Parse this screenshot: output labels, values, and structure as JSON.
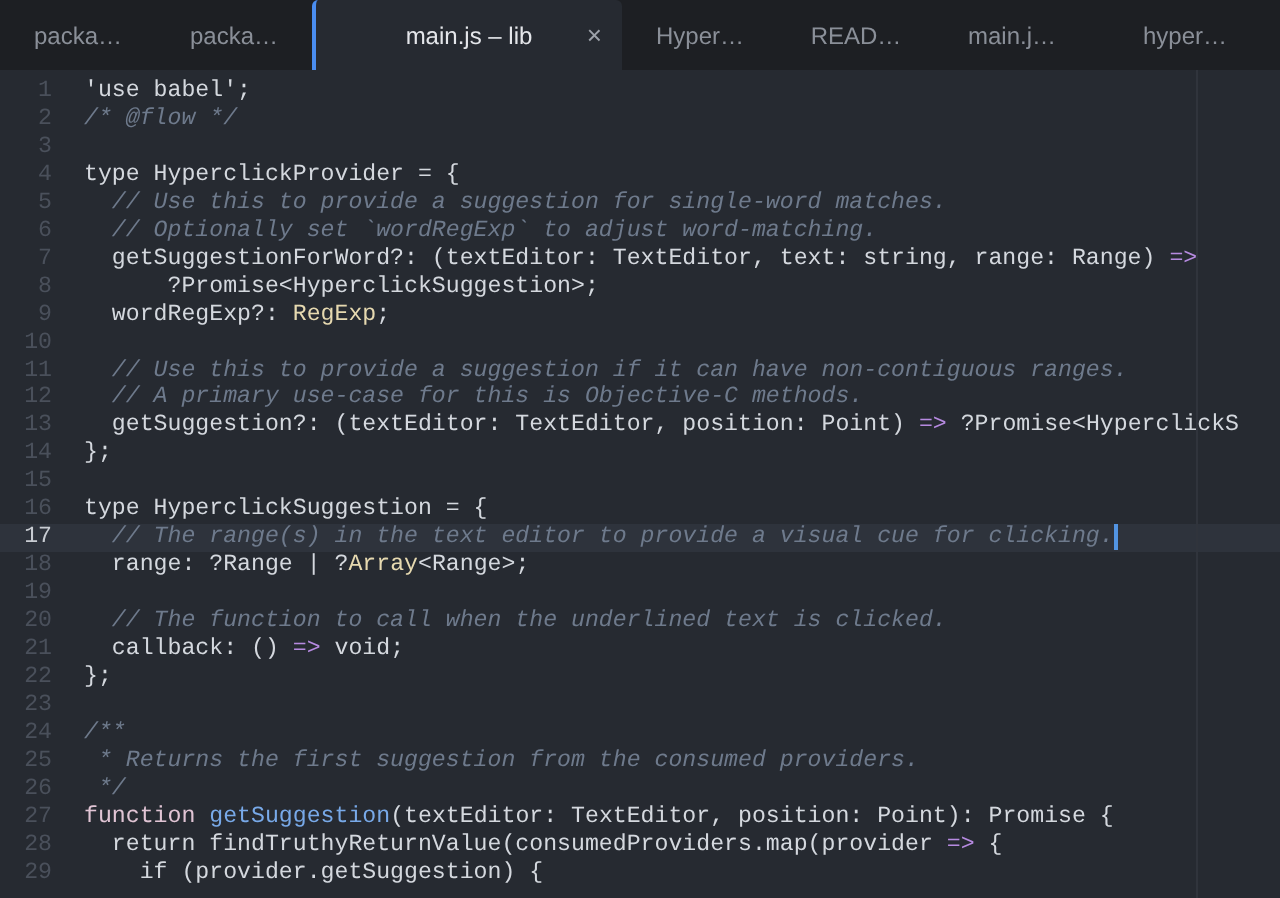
{
  "tabs": [
    {
      "label": "packa…",
      "selected": false
    },
    {
      "label": "packa…",
      "selected": false
    },
    {
      "label": "main.js – lib",
      "selected": true,
      "close": "×"
    },
    {
      "label": "Hyper…",
      "selected": false
    },
    {
      "label": "READ…",
      "selected": false
    },
    {
      "label": "main.j…",
      "selected": false
    },
    {
      "label": "hyper…",
      "selected": false
    }
  ],
  "editor": {
    "lines": [
      {
        "number": "1",
        "current": false,
        "tokens": [
          {
            "kind": "plain",
            "text": "'use babel';"
          }
        ]
      },
      {
        "number": "2",
        "current": false,
        "tokens": [
          {
            "kind": "comment",
            "text": "/* @flow */"
          }
        ]
      },
      {
        "number": "3",
        "current": false
      },
      {
        "number": "4",
        "current": false,
        "tokens": [
          {
            "kind": "plain",
            "text": "type HyperclickProvider = {"
          }
        ]
      },
      {
        "number": "5",
        "current": false,
        "tokens": [
          {
            "kind": "comment",
            "text": "  // Use this to provide a suggestion for single-word matches."
          }
        ]
      },
      {
        "number": "6",
        "current": false,
        "tokens": [
          {
            "kind": "comment",
            "text": "  // Optionally set `wordRegExp` to adjust word-matching."
          }
        ]
      },
      {
        "number": "7",
        "current": false,
        "tokens": [
          {
            "kind": "plain",
            "text": "  getSuggestionForWord?: (textEditor: TextEditor, text: string, range: Range) "
          },
          {
            "kind": "operator",
            "text": "=>"
          }
        ]
      },
      {
        "number": "8",
        "current": false,
        "tokens": [
          {
            "kind": "plain",
            "text": "      ?Promise<HyperclickSuggestion>;"
          }
        ]
      },
      {
        "number": "9",
        "current": false,
        "tokens": [
          {
            "kind": "plain",
            "text": "  wordRegExp?: "
          },
          {
            "kind": "type",
            "text": "RegExp"
          },
          {
            "kind": "plain",
            "text": ";"
          }
        ]
      },
      {
        "number": "10",
        "current": false
      },
      {
        "number": "11",
        "current": false,
        "tokens": [
          {
            "kind": "comment",
            "text": "  // Use this to provide a suggestion if it can have non-contiguous ranges."
          }
        ]
      },
      {
        "number": "12",
        "current": false,
        "tokens": [
          {
            "kind": "comment",
            "text": "  // A primary use-case for this is Objective-C methods."
          }
        ]
      },
      {
        "number": "13",
        "current": false,
        "tokens": [
          {
            "kind": "plain",
            "text": "  getSuggestion?: (textEditor: TextEditor, position: Point) "
          },
          {
            "kind": "operator",
            "text": "=>"
          },
          {
            "kind": "plain",
            "text": " ?Promise<HyperclickS"
          }
        ]
      },
      {
        "number": "14",
        "current": false,
        "tokens": [
          {
            "kind": "plain",
            "text": "};"
          }
        ]
      },
      {
        "number": "15",
        "current": false
      },
      {
        "number": "16",
        "current": false,
        "tokens": [
          {
            "kind": "plain",
            "text": "type HyperclickSuggestion = {"
          }
        ]
      },
      {
        "number": "17",
        "current": true,
        "tokens": [
          {
            "kind": "comment",
            "text": "  // The range(s) in the text editor to provide a visual cue for clicking."
          }
        ]
      },
      {
        "number": "18",
        "current": false,
        "tokens": [
          {
            "kind": "plain",
            "text": "  range: ?Range | ?"
          },
          {
            "kind": "type",
            "text": "Array"
          },
          {
            "kind": "plain",
            "text": "<Range>;"
          }
        ]
      },
      {
        "number": "19",
        "current": false
      },
      {
        "number": "20",
        "current": false,
        "tokens": [
          {
            "kind": "comment",
            "text": "  // The function to call when the underlined text is clicked."
          }
        ]
      },
      {
        "number": "21",
        "current": false,
        "tokens": [
          {
            "kind": "plain",
            "text": "  callback: () "
          },
          {
            "kind": "operator",
            "text": "=>"
          },
          {
            "kind": "plain",
            "text": " void;"
          }
        ]
      },
      {
        "number": "22",
        "current": false,
        "tokens": [
          {
            "kind": "plain",
            "text": "};"
          }
        ]
      },
      {
        "number": "23",
        "current": false
      },
      {
        "number": "24",
        "current": false,
        "tokens": [
          {
            "kind": "comment",
            "text": "/**"
          }
        ]
      },
      {
        "number": "25",
        "current": false,
        "tokens": [
          {
            "kind": "comment",
            "text": " * Returns the first suggestion from the consumed providers."
          }
        ]
      },
      {
        "number": "26",
        "current": false,
        "tokens": [
          {
            "kind": "comment",
            "text": " */"
          }
        ]
      },
      {
        "number": "27",
        "current": false,
        "tokens": [
          {
            "kind": "keyword",
            "text": "function "
          },
          {
            "kind": "function",
            "text": "getSuggestion"
          },
          {
            "kind": "plain",
            "text": "(textEditor: TextEditor, position: Point): Promise {"
          }
        ]
      },
      {
        "number": "28",
        "current": false,
        "tokens": [
          {
            "kind": "plain",
            "text": "  return findTruthyReturnValue(consumedProviders.map(provider "
          },
          {
            "kind": "operator",
            "text": "=>"
          },
          {
            "kind": "plain",
            "text": " {"
          }
        ]
      },
      {
        "number": "29",
        "current": false,
        "tokens": [
          {
            "kind": "plain",
            "text": "    if (provider.getSuggestion) {"
          }
        ]
      }
    ]
  }
}
